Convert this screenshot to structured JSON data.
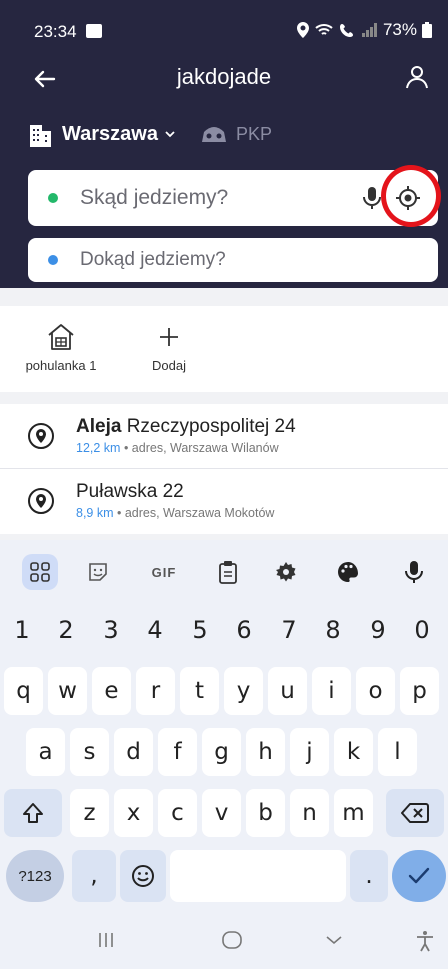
{
  "status_bar": {
    "time": "23:34",
    "battery": "73%"
  },
  "app": {
    "title": "jakdojade"
  },
  "city": {
    "name": "Warszawa",
    "secondary_label": "PKP"
  },
  "search": {
    "from_placeholder": "Skąd jedziemy?",
    "to_placeholder": "Dokąd jedziemy?"
  },
  "shortcuts": [
    {
      "label": "pohulanka 1",
      "icon": "home-icon"
    },
    {
      "label": "Dodaj",
      "icon": "plus-icon"
    }
  ],
  "results": [
    {
      "title_bold": "Aleja",
      "title_rest": " Rzeczypospolitej 24",
      "distance": "12,2 km",
      "details": "adres, Warszawa Wilanów"
    },
    {
      "title_bold": "",
      "title_rest": "Puławska 22",
      "distance": "8,9 km",
      "details": "adres, Warszawa Mokotów"
    }
  ],
  "keyboard": {
    "toolbar": [
      "apps-grid-icon",
      "sticker-icon",
      "GIF",
      "clipboard-icon",
      "settings-icon",
      "palette-icon",
      "mic-icon"
    ],
    "gif_label": "GIF",
    "row_numbers": [
      "1",
      "2",
      "3",
      "4",
      "5",
      "6",
      "7",
      "8",
      "9",
      "0"
    ],
    "row_1": [
      "q",
      "w",
      "e",
      "r",
      "t",
      "y",
      "u",
      "i",
      "o",
      "p"
    ],
    "row_2": [
      "a",
      "s",
      "d",
      "f",
      "g",
      "h",
      "j",
      "k",
      "l"
    ],
    "row_3": [
      "z",
      "x",
      "c",
      "v",
      "b",
      "n",
      "m"
    ],
    "symbols_label": "?123",
    "comma": ",",
    "period": "."
  },
  "colors": {
    "header_bg": "#262640",
    "accent_green": "#23b86a",
    "accent_blue": "#3c8fe6",
    "highlight_red": "#e4141b",
    "enter_key": "#80aee8"
  }
}
